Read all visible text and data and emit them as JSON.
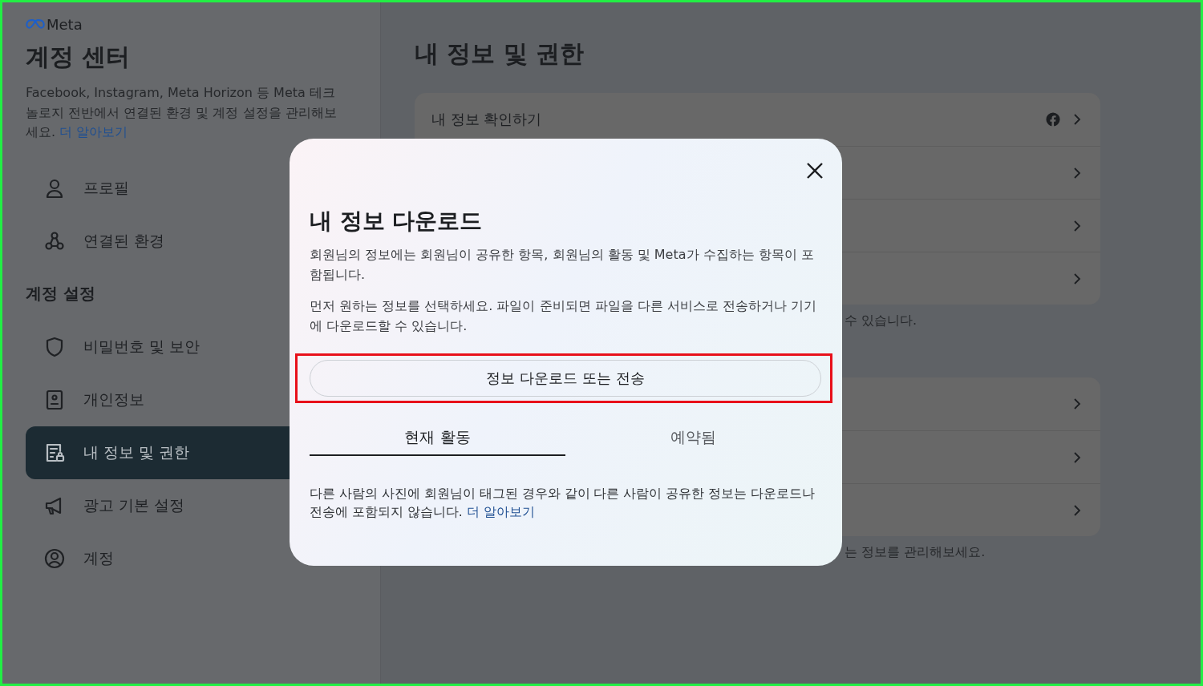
{
  "brand": {
    "name": "Meta"
  },
  "sidebar": {
    "title": "계정 센터",
    "description": "Facebook, Instagram, Meta Horizon 등 Meta 테크놀로지 전반에서 연결된 환경 및 계정 설정을 관리해보세요.",
    "learn_more": "더 알아보기",
    "sections": [
      {
        "items": [
          {
            "label": "프로필",
            "selected": false
          },
          {
            "label": "연결된 환경",
            "selected": false
          }
        ]
      },
      {
        "title": "계정 설정",
        "items": [
          {
            "label": "비밀번호 및 보안",
            "selected": false
          },
          {
            "label": "개인정보",
            "selected": false
          },
          {
            "label": "내 정보 및 권한",
            "selected": true
          },
          {
            "label": "광고 기본 설정",
            "selected": false
          },
          {
            "label": "계정",
            "selected": false
          }
        ]
      }
    ]
  },
  "main": {
    "title": "내 정보 및 권한",
    "groups": [
      {
        "rows": [
          {
            "label": "내 정보 확인하기",
            "facebook_icon": true
          },
          {
            "facebook_icon": false
          },
          {
            "facebook_icon": false
          },
          {
            "facebook_icon": false
          }
        ],
        "note": "수 있습니다."
      },
      {
        "rows": [
          {
            "facebook_icon": false
          },
          {
            "facebook_icon": false
          },
          {
            "facebook_icon": false
          }
        ],
        "note": "는 정보를 관리해보세요."
      }
    ]
  },
  "dialog": {
    "title": "내 정보 다운로드",
    "paragraphs": [
      "회원님의 정보에는 회원님이 공유한 항목, 회원님의 활동 및 Meta가 수집하는 항목이 포함됩니다.",
      "먼저 원하는 정보를 선택하세요. 파일이 준비되면 파일을 다른 서비스로 전송하거나 기기에 다운로드할 수 있습니다."
    ],
    "button": "정보 다운로드 또는 전송",
    "button_highlighted": true,
    "tabs": [
      {
        "label": "현재 활동",
        "selected": true
      },
      {
        "label": "예약됨",
        "selected": false
      }
    ],
    "note": "다른 사람의 사진에 회원님이 태그된 경우와 같이 다른 사람이 공유한 정보는 다운로드나 전송에 포함되지 않습니다.",
    "note_link": "더 알아보기"
  }
}
